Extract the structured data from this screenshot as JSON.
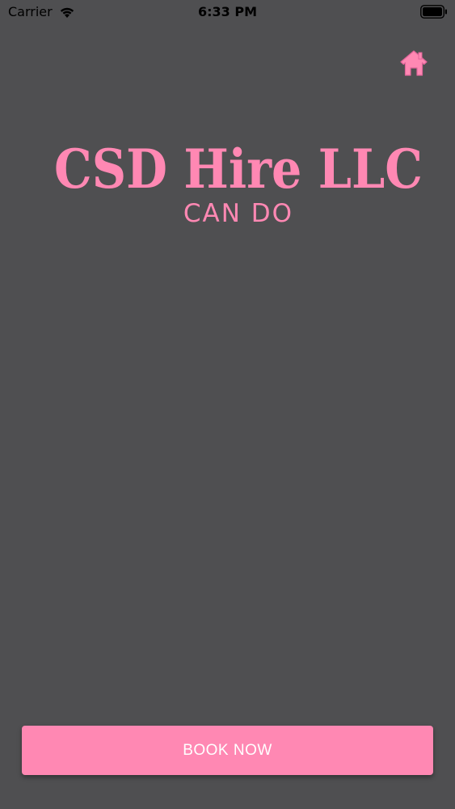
{
  "status_bar": {
    "carrier": "Carrier",
    "time": "6:33 PM"
  },
  "header": {
    "home_icon": "home-icon"
  },
  "brand": {
    "title": "CSD Hire LLC",
    "tagline": "CAN DO"
  },
  "actions": {
    "book_now_label": "BOOK NOW"
  },
  "colors": {
    "background": "#4f4f51",
    "accent_pink": "#ff88b3",
    "button_text": "#ffffff"
  }
}
